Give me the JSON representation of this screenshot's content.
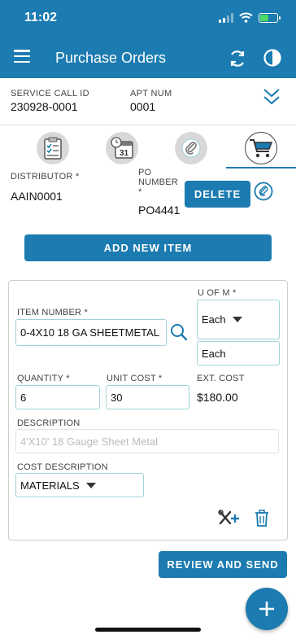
{
  "status_bar": {
    "time": "11:02"
  },
  "app_bar": {
    "title": "Purchase Orders",
    "menu_icon": "hamburger-menu-icon",
    "refresh_icon": "refresh-icon",
    "contrast_icon": "contrast-icon"
  },
  "header": {
    "service_call_label": "SERVICE CALL ID",
    "service_call_value": "230928-0001",
    "apt_num_label": "APT NUM",
    "apt_num_value": "0001",
    "expand_icon": "chevron-double-down-icon"
  },
  "tabs": [
    {
      "icon": "clipboard-checklist-icon",
      "active": false
    },
    {
      "icon": "calendar-icon",
      "day": "31",
      "active": false
    },
    {
      "icon": "paperclip-icon",
      "active": false
    },
    {
      "icon": "shopping-cart-icon",
      "active": true
    }
  ],
  "po": {
    "distributor_label": "DISTRIBUTOR *",
    "distributor_value": "AAIN0001",
    "po_number_label_1": "PO",
    "po_number_label_2": "NUMBER",
    "po_number_label_3": "*",
    "po_number_value": "PO4441",
    "delete_label": "DELETE",
    "add_item_label": "ADD NEW ITEM"
  },
  "item": {
    "item_number_label": "ITEM NUMBER *",
    "item_number_value": "0-4X10 18 GA SHEETMETAL",
    "uom_label": "U OF M *",
    "uom_select": "Each",
    "uom_text": "Each",
    "quantity_label": "QUANTITY *",
    "quantity_value": "6",
    "unit_cost_label": "UNIT COST *",
    "unit_cost_value": "30",
    "ext_cost_label": "EXT. COST",
    "ext_cost_value": "$180.00",
    "description_label": "DESCRIPTION",
    "description_value": "4'X10' 18 Gauge Sheet Metal",
    "cost_description_label": "COST DESCRIPTION",
    "cost_description_value": "MATERIALS"
  },
  "actions": {
    "review_send_label": "REVIEW AND SEND",
    "fab_icon": "plus-icon"
  },
  "colors": {
    "primary": "#1c7bb0",
    "field_border": "#9fd3d6"
  }
}
